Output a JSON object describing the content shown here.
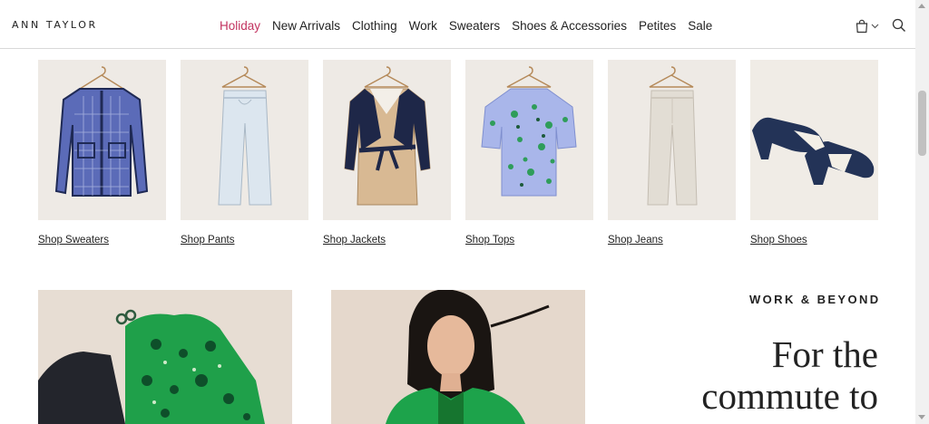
{
  "header": {
    "logo": "ANN TAYLOR",
    "nav": [
      {
        "label": "Holiday",
        "active": true
      },
      {
        "label": "New Arrivals"
      },
      {
        "label": "Clothing"
      },
      {
        "label": "Work"
      },
      {
        "label": "Sweaters"
      },
      {
        "label": "Shoes & Accessories"
      },
      {
        "label": "Petites"
      },
      {
        "label": "Sale"
      }
    ],
    "icons": [
      "shopping-bag-icon",
      "chevron-down-icon",
      "search-icon"
    ]
  },
  "categories": [
    {
      "label": "Shop Sweaters"
    },
    {
      "label": "Shop Pants"
    },
    {
      "label": "Shop Jackets"
    },
    {
      "label": "Shop Tops"
    },
    {
      "label": "Shop Jeans"
    },
    {
      "label": "Shop Shoes"
    }
  ],
  "feature": {
    "eyebrow": "WORK & BEYOND",
    "headline_line1": "For the",
    "headline_line2": "commute to"
  },
  "colors": {
    "accent": "#c2325f",
    "tile_bg": "#eeeae5",
    "text": "#222222"
  }
}
